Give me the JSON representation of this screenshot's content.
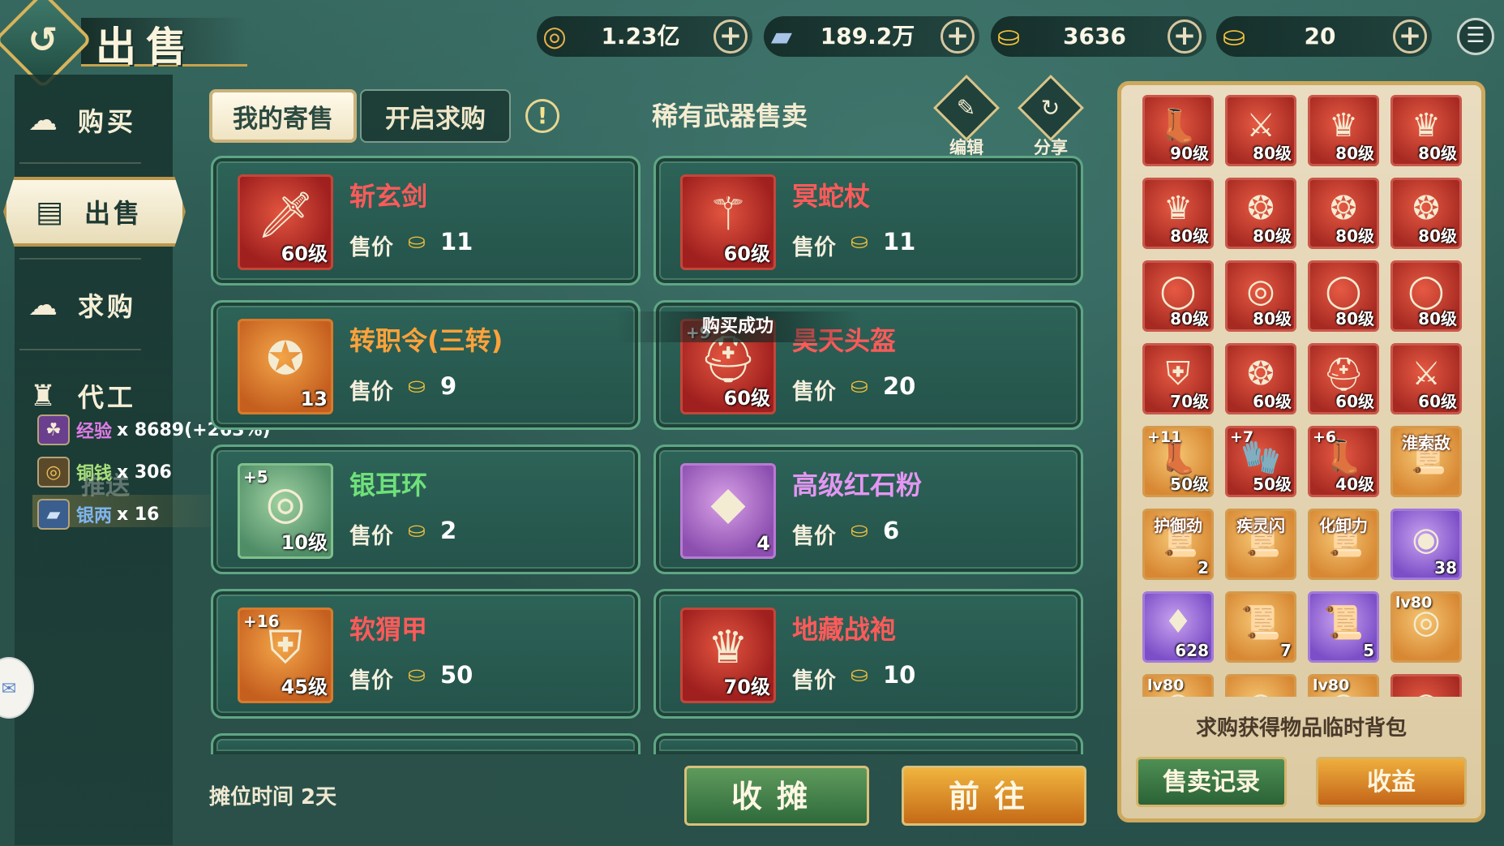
{
  "header": {
    "title": "出售",
    "currencies": [
      {
        "name": "copper-coin",
        "value": "1.23亿",
        "icon": "◎"
      },
      {
        "name": "silver-ingot",
        "value": "189.2万",
        "icon": "▰"
      },
      {
        "name": "gold-ingot-bound",
        "value": "3636",
        "icon": "⛀"
      },
      {
        "name": "gold-ingot",
        "value": "20",
        "icon": "⛀"
      }
    ]
  },
  "nav": {
    "items": [
      {
        "label": "购买",
        "icon": "☁"
      },
      {
        "label": "出售",
        "icon": "▤"
      },
      {
        "label": "求购",
        "icon": "☁"
      },
      {
        "label": "代工",
        "icon": "♜"
      }
    ]
  },
  "rewards": [
    {
      "name": "经验",
      "count": "x 8689(+263%)",
      "color": "#e07be8",
      "icon": "☘"
    },
    {
      "name": "铜钱",
      "count": "x 306",
      "color": "#a8e07a",
      "icon": "◎"
    },
    {
      "name": "银两",
      "count": "x 16",
      "color": "#7fb4ee",
      "icon": "▰"
    }
  ],
  "obscured_nav_label": "推送",
  "tabs": {
    "my_sales": "我的寄售",
    "open_request": "开启求购"
  },
  "panel_heading": "稀有武器售卖",
  "tools": {
    "edit": "编辑",
    "share": "分享"
  },
  "price_label": "售价",
  "toast": "购买成功",
  "cards": [
    {
      "name": "斩玄剑",
      "level": "60级",
      "price": "11",
      "color": "#ff5a5a",
      "art": "🗡",
      "plus": ""
    },
    {
      "name": "冥蛇杖",
      "level": "60级",
      "price": "11",
      "color": "#ff5a5a",
      "art": "⚚",
      "plus": ""
    },
    {
      "name": "转职令(三转)",
      "level": "13",
      "price": "9",
      "color": "#ffa23a",
      "art": "✪",
      "plus": ""
    },
    {
      "name": "昊天头盔",
      "level": "60级",
      "price": "20",
      "color": "#ff5a5a",
      "art": "⛑",
      "plus": "+9"
    },
    {
      "name": "银耳环",
      "level": "10级",
      "price": "2",
      "color": "#6fe07a",
      "art": "◎",
      "plus": "+5"
    },
    {
      "name": "高级红石粉",
      "level": "4",
      "price": "6",
      "color": "#e496f2",
      "art": "◆",
      "plus": ""
    },
    {
      "name": "软猬甲",
      "level": "45级",
      "price": "50",
      "color": "#ff5a5a",
      "art": "⛨",
      "plus": "+16"
    },
    {
      "name": "地藏战袍",
      "level": "70级",
      "price": "10",
      "color": "#ff5a5a",
      "art": "♛",
      "plus": ""
    }
  ],
  "stall_time": "摊位时间 2天",
  "buttons": {
    "close_stall": "收摊",
    "go": "前往"
  },
  "inventory": {
    "note": "求购获得物品临时背包",
    "records_button": "售卖记录",
    "earnings_button": "收益",
    "slots": [
      {
        "bg": "red",
        "label": "90级",
        "plus": "",
        "title": "",
        "art": "👢"
      },
      {
        "bg": "red",
        "label": "80级",
        "plus": "",
        "title": "",
        "art": "⚔"
      },
      {
        "bg": "red",
        "label": "80级",
        "plus": "",
        "title": "",
        "art": "♛"
      },
      {
        "bg": "red",
        "label": "80级",
        "plus": "",
        "title": "",
        "art": "♛"
      },
      {
        "bg": "red",
        "label": "80级",
        "plus": "",
        "title": "",
        "art": "♛"
      },
      {
        "bg": "red",
        "label": "80级",
        "plus": "",
        "title": "",
        "art": "❂"
      },
      {
        "bg": "red",
        "label": "80级",
        "plus": "",
        "title": "",
        "art": "❂"
      },
      {
        "bg": "red",
        "label": "80级",
        "plus": "",
        "title": "",
        "art": "❂"
      },
      {
        "bg": "red",
        "label": "80级",
        "plus": "",
        "title": "",
        "art": "◯"
      },
      {
        "bg": "red",
        "label": "80级",
        "plus": "",
        "title": "",
        "art": "◎"
      },
      {
        "bg": "red",
        "label": "80级",
        "plus": "",
        "title": "",
        "art": "◯"
      },
      {
        "bg": "red",
        "label": "80级",
        "plus": "",
        "title": "",
        "art": "◯"
      },
      {
        "bg": "red",
        "label": "70级",
        "plus": "",
        "title": "",
        "art": "⛨"
      },
      {
        "bg": "red",
        "label": "60级",
        "plus": "",
        "title": "",
        "art": "❂"
      },
      {
        "bg": "red",
        "label": "60级",
        "plus": "",
        "title": "",
        "art": "⛑"
      },
      {
        "bg": "red",
        "label": "60级",
        "plus": "",
        "title": "",
        "art": "⚔"
      },
      {
        "bg": "orange",
        "label": "50级",
        "plus": "+11",
        "title": "",
        "art": "👢"
      },
      {
        "bg": "red",
        "label": "50级",
        "plus": "+7",
        "title": "",
        "art": "🧤"
      },
      {
        "bg": "red",
        "label": "40级",
        "plus": "+6",
        "title": "",
        "art": "👢"
      },
      {
        "bg": "orange",
        "label": "",
        "plus": "",
        "title": "淮索敌",
        "art": "📜"
      },
      {
        "bg": "orange",
        "label": "2",
        "plus": "",
        "title": "护御劲",
        "art": "📜"
      },
      {
        "bg": "orange",
        "label": "",
        "plus": "",
        "title": "疾灵闪",
        "art": "📜"
      },
      {
        "bg": "orange",
        "label": "",
        "plus": "",
        "title": "化卸力",
        "art": "📜"
      },
      {
        "bg": "purple",
        "label": "38",
        "plus": "",
        "title": "",
        "art": "◉"
      },
      {
        "bg": "purple",
        "label": "628",
        "plus": "",
        "title": "",
        "art": "♦"
      },
      {
        "bg": "orange",
        "label": "7",
        "plus": "",
        "title": "",
        "art": "📜"
      },
      {
        "bg": "purple",
        "label": "5",
        "plus": "",
        "title": "",
        "art": "📜"
      },
      {
        "bg": "orange",
        "label": "",
        "plus": "lv80",
        "title": "",
        "art": "◎"
      },
      {
        "bg": "orange",
        "label": "",
        "plus": "lv80",
        "title": "",
        "art": "◎"
      },
      {
        "bg": "orange",
        "label": "",
        "plus": "",
        "title": "",
        "art": "◎"
      },
      {
        "bg": "orange",
        "label": "",
        "plus": "lv80",
        "title": "",
        "art": "◎"
      },
      {
        "bg": "red",
        "label": "",
        "plus": "",
        "title": "",
        "art": "◎"
      }
    ]
  }
}
